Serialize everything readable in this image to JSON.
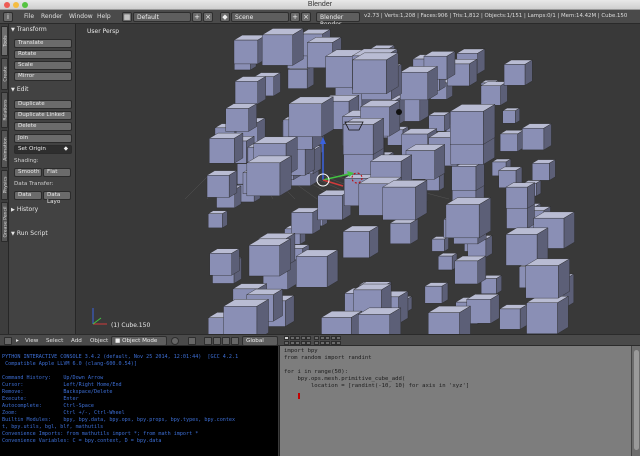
{
  "window": {
    "title": "Blender"
  },
  "menu": {
    "items": [
      "File",
      "Render",
      "Window",
      "Help"
    ]
  },
  "screen_layout": "Default",
  "scene_name": "Scene",
  "render_engine": "Blender Render",
  "stats": "v2.73 | Verts:1,208 | Faces:906 | Tris:1,812 | Objects:1/151 | Lamps:0/1 | Mem:14.42M | Cube.150",
  "tabs": [
    "Tools",
    "Create",
    "Relations",
    "Animation",
    "Physics",
    "Grease Pencil"
  ],
  "toolshelf": {
    "transform_header": "Transform",
    "translate": "Translate",
    "rotate": "Rotate",
    "scale": "Scale",
    "mirror": "Mirror",
    "edit_header": "Edit",
    "duplicate": "Duplicate",
    "duplicate_linked": "Duplicate Linked",
    "delete": "Delete",
    "join": "Join",
    "set_origin": "Set Origin",
    "shading_label": "Shading:",
    "smooth": "Smooth",
    "flat": "Flat",
    "data_transfer_label": "Data Transfer:",
    "data": "Data",
    "data_layout": "Data Layo",
    "history_header": "History",
    "run_script_header": "Run Script"
  },
  "viewport": {
    "view_label": "User Persp",
    "object_label": "(1) Cube.150"
  },
  "view_header": {
    "view": "View",
    "select": "Select",
    "add": "Add",
    "object": "Object",
    "mode": "Object Mode",
    "orientation": "Global"
  },
  "console": {
    "header_lines": [
      "PYTHON INTERACTIVE CONSOLE 3.4.2 (default, Nov 25 2014, 12:01:44)  [GCC 4.2.1",
      " Compatible Apple LLVM 6.0 (clang-600.0.54)]"
    ],
    "help_lines": [
      "Command History:    Up/Down Arrow",
      "Cursor:             Left/Right Home/End",
      "Remove:             Backspace/Delete",
      "Execute:            Enter",
      "Autocomplete:       Ctrl-Space",
      "Zoom:               Ctrl +/-, Ctrl-Wheel",
      "Builtin Modules:    bpy, bpy.data, bpy.ops, bpy.props, bpy.types, bpy.contex",
      "t, bpy.utils, bgl, blf, mathutils",
      "Convenience Imports: from mathutils import *; from math import *",
      "Convenience Variables: C = bpy.context, D = bpy.data"
    ]
  },
  "script": {
    "lines": [
      "import bpy",
      "from random import randint",
      "",
      "for i in range(50):",
      "    bpy.ops.mesh.primitive_cube_add(",
      "        location = [randint(-10, 10) for axis in 'xyz']"
    ]
  },
  "colors": {
    "viewport_bg": "#393939",
    "cube_face": "#8a8fb5",
    "console_text": "#3d6fd6",
    "cursor_red": "#c40000"
  }
}
